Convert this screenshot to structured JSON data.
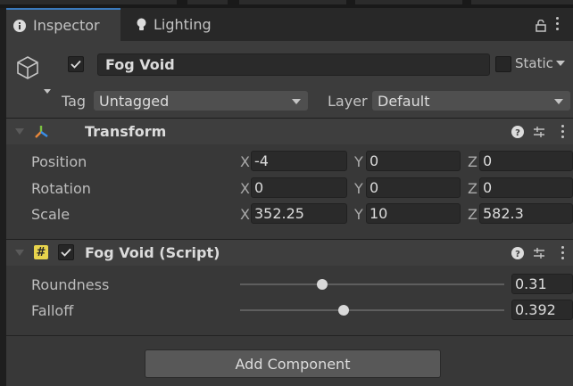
{
  "tabs": [
    {
      "label": "Inspector",
      "icon": "info-icon",
      "active": true
    },
    {
      "label": "Lighting",
      "icon": "lightbulb-icon",
      "active": false
    }
  ],
  "object": {
    "enabled": true,
    "name": "Fog Void",
    "static_label": "Static",
    "tag_label": "Tag",
    "tag_value": "Untagged",
    "layer_label": "Layer",
    "layer_value": "Default"
  },
  "transform": {
    "title": "Transform",
    "rows": [
      {
        "label": "Position",
        "x": "-4",
        "y": "0",
        "z": "0"
      },
      {
        "label": "Rotation",
        "x": "0",
        "y": "0",
        "z": "0"
      },
      {
        "label": "Scale",
        "x": "352.25",
        "y": "10",
        "z": "582.3"
      }
    ],
    "axes": [
      "X",
      "Y",
      "Z"
    ]
  },
  "script_component": {
    "title": "Fog Void (Script)",
    "enabled": true,
    "icon_glyph": "#",
    "sliders": [
      {
        "label": "Roundness",
        "value": "0.31",
        "fraction": 0.31
      },
      {
        "label": "Falloff",
        "value": "0.392",
        "fraction": 0.392
      }
    ]
  },
  "add_component_label": "Add Component",
  "colors": {
    "panel_bg": "#383838",
    "field_bg": "#2a2a2a",
    "tab_accent": "#3a79bb",
    "script_icon_bg": "#e8d44d"
  }
}
